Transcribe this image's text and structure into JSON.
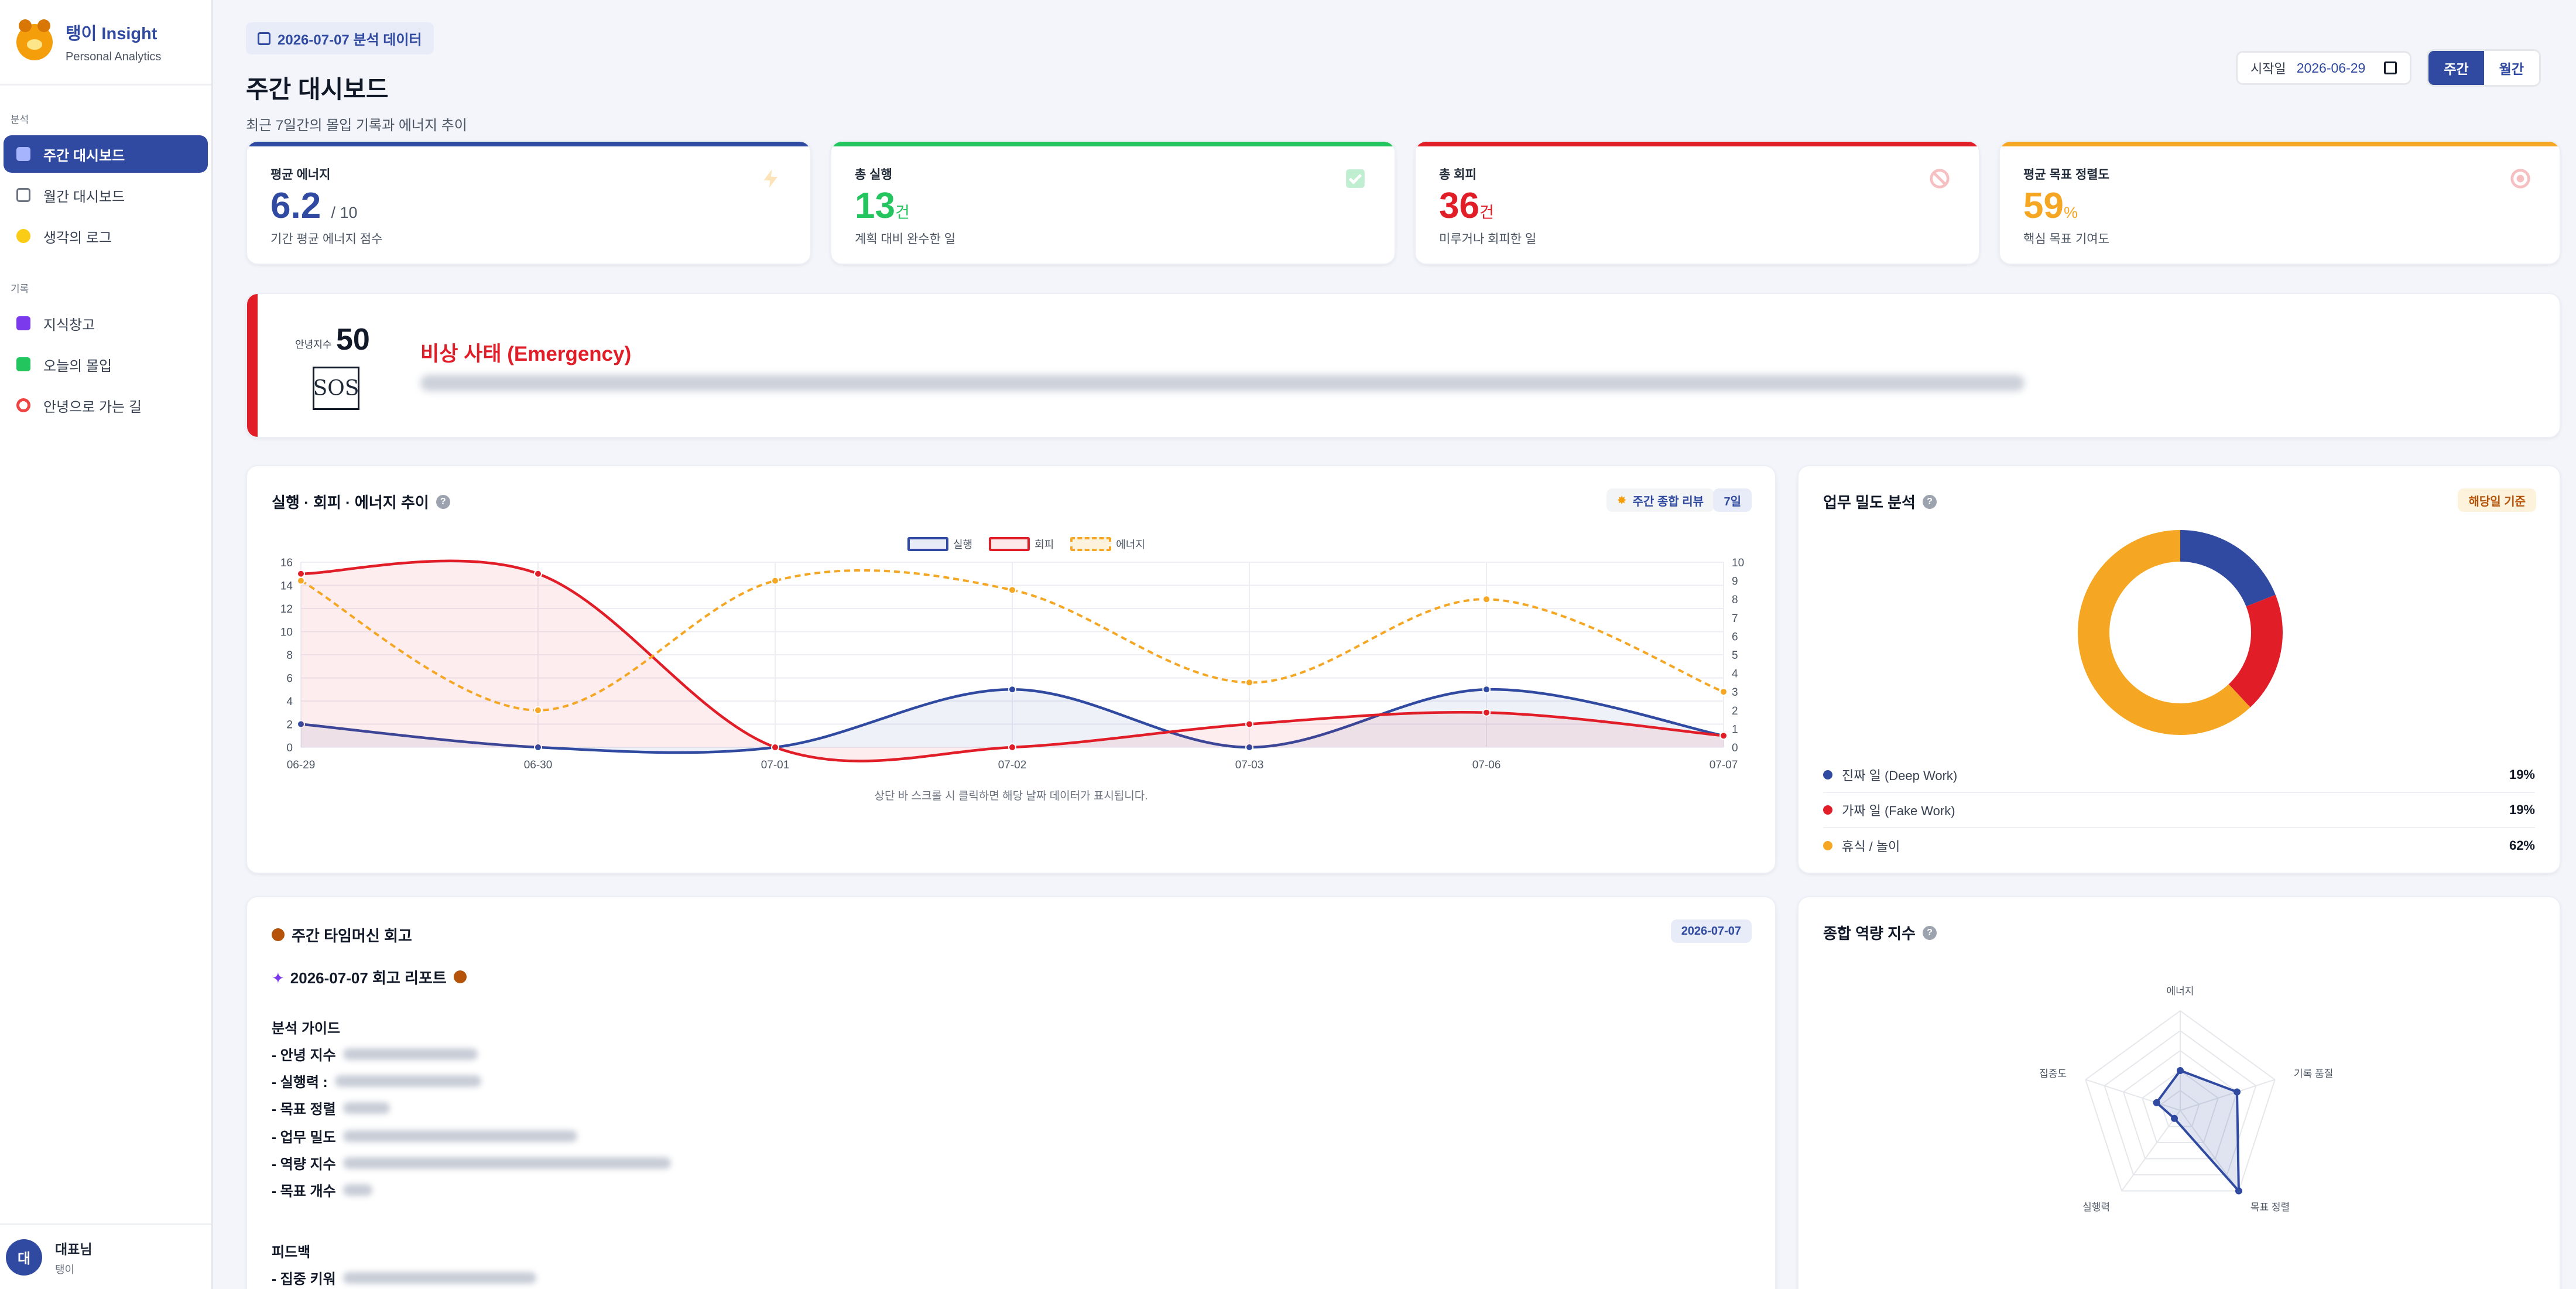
{
  "brand": {
    "title": "탱이 Insight",
    "subtitle": "Personal Analytics"
  },
  "nav": {
    "section_analysis": "분석",
    "section_record": "기록",
    "items": [
      {
        "label": "주간 대시보드",
        "icon": "chart-bar-icon",
        "active": true
      },
      {
        "label": "월간 대시보드",
        "icon": "calendar-icon"
      },
      {
        "label": "생각의 로그",
        "icon": "lightbulb-icon"
      },
      {
        "label": "지식창고",
        "icon": "book-icon"
      },
      {
        "label": "오늘의 몰입",
        "icon": "check-box-icon"
      },
      {
        "label": "안녕으로 가는 길",
        "icon": "target-icon"
      }
    ]
  },
  "user": {
    "initial": "대",
    "name": "대표님",
    "sub": "탱이"
  },
  "header": {
    "date_chip": "2026-07-07 분석 데이터",
    "title": "주간 대시보드",
    "subtitle": "최근 7일간의 몰입 기록과 에너지 추이"
  },
  "controls": {
    "start_label": "시작일",
    "start_value": "2026-06-29",
    "weekly": "주간",
    "monthly": "월간"
  },
  "kpis": [
    {
      "label": "평균 에너지",
      "value": "6.2",
      "unit": "/ 10",
      "desc": "기간 평균 에너지 점수",
      "color": "#2f4aa0",
      "icon": "lightning-icon"
    },
    {
      "label": "총 실행",
      "value": "13",
      "unit": "건",
      "desc": "계획 대비 완수한 일",
      "color": "#22c55e",
      "icon": "check-icon"
    },
    {
      "label": "총 회피",
      "value": "36",
      "unit": "건",
      "desc": "미루거나 회피한 일",
      "color": "#e11d28",
      "icon": "prohibited-icon"
    },
    {
      "label": "평균 목표 정렬도",
      "value": "59",
      "unit": "%",
      "desc": "핵심 목표 기여도",
      "color": "#f5a623",
      "icon": "target-icon"
    }
  ],
  "alert": {
    "index_label": "안녕지수",
    "index_value": "50",
    "badge": "SOS",
    "title": "비상 사태 (Emergency)"
  },
  "trend": {
    "title": "실행 · 회피 · 에너지 추이",
    "review_button": "주간 종합 리뷰",
    "range_badge": "7일",
    "hint": "상단 바 스크롤 시 클릭하면 해당 날짜 데이터가 표시됩니다."
  },
  "chart_data": [
    {
      "type": "line",
      "title": "실행 · 회피 · 에너지 추이",
      "categories": [
        "06-29",
        "06-30",
        "07-01",
        "07-02",
        "07-03",
        "07-06",
        "07-07"
      ],
      "series": [
        {
          "name": "실행",
          "values": [
            2,
            0,
            0,
            5,
            0,
            5,
            1
          ],
          "axis": "left",
          "color": "#2f4aa0",
          "fill": true
        },
        {
          "name": "회피",
          "values": [
            15,
            15,
            0,
            0,
            2,
            3,
            1
          ],
          "axis": "left",
          "color": "#e11d28",
          "fill": true
        },
        {
          "name": "에너지",
          "values": [
            9,
            2,
            9,
            8.5,
            3.5,
            8,
            3
          ],
          "axis": "right",
          "color": "#f5a623",
          "dashed": true
        }
      ],
      "ylim_left": [
        0,
        16
      ],
      "yticks_left": [
        0,
        2,
        4,
        6,
        8,
        10,
        12,
        14,
        16
      ],
      "ylim_right": [
        0,
        10
      ],
      "yticks_right": [
        0,
        1,
        2,
        3,
        4,
        5,
        6,
        7,
        8,
        9,
        10
      ],
      "grid": true,
      "legend": "top-center"
    },
    {
      "type": "pie",
      "title": "업무 밀도 분석",
      "donut": true,
      "categories": [
        "진짜 일 (Deep Work)",
        "가짜 일 (Fake Work)",
        "휴식 / 놀이"
      ],
      "values": [
        19,
        19,
        62
      ],
      "colors": [
        "#2f4aa0",
        "#e11d28",
        "#f5a623"
      ],
      "legend": "bottom"
    },
    {
      "type": "radar",
      "title": "종합 역량 지수",
      "categories": [
        "에너지",
        "기록 품질",
        "목표 정렬",
        "실행력",
        "집중도"
      ],
      "values": [
        40,
        60,
        100,
        10,
        25
      ],
      "max": 100,
      "color": "#2f4aa0"
    }
  ],
  "density": {
    "title": "업무 밀도 분석",
    "badge": "해당일 기준",
    "legend": [
      {
        "label": "진짜 일 (Deep Work)",
        "pct": "19%",
        "color": "#2f4aa0"
      },
      {
        "label": "가짜 일 (Fake Work)",
        "pct": "19%",
        "color": "#e11d28"
      },
      {
        "label": "휴식 / 놀이",
        "pct": "62%",
        "color": "#f5a623"
      }
    ]
  },
  "review": {
    "title": "주간 타임머신 회고",
    "date_badge": "2026-07-07",
    "report_title": "2026-07-07 회고 리포트",
    "guide_title": "분석 가이드",
    "guide_items": [
      "- 안녕 지수",
      "- 실행력 :",
      "- 목표 정렬",
      "- 업무 밀도",
      "- 역량 지수",
      "- 목표 개수"
    ],
    "feedback_title": "피드백",
    "feedback_items": [
      "- 집중 키워"
    ]
  },
  "radar": {
    "title": "종합 역량 지수"
  }
}
